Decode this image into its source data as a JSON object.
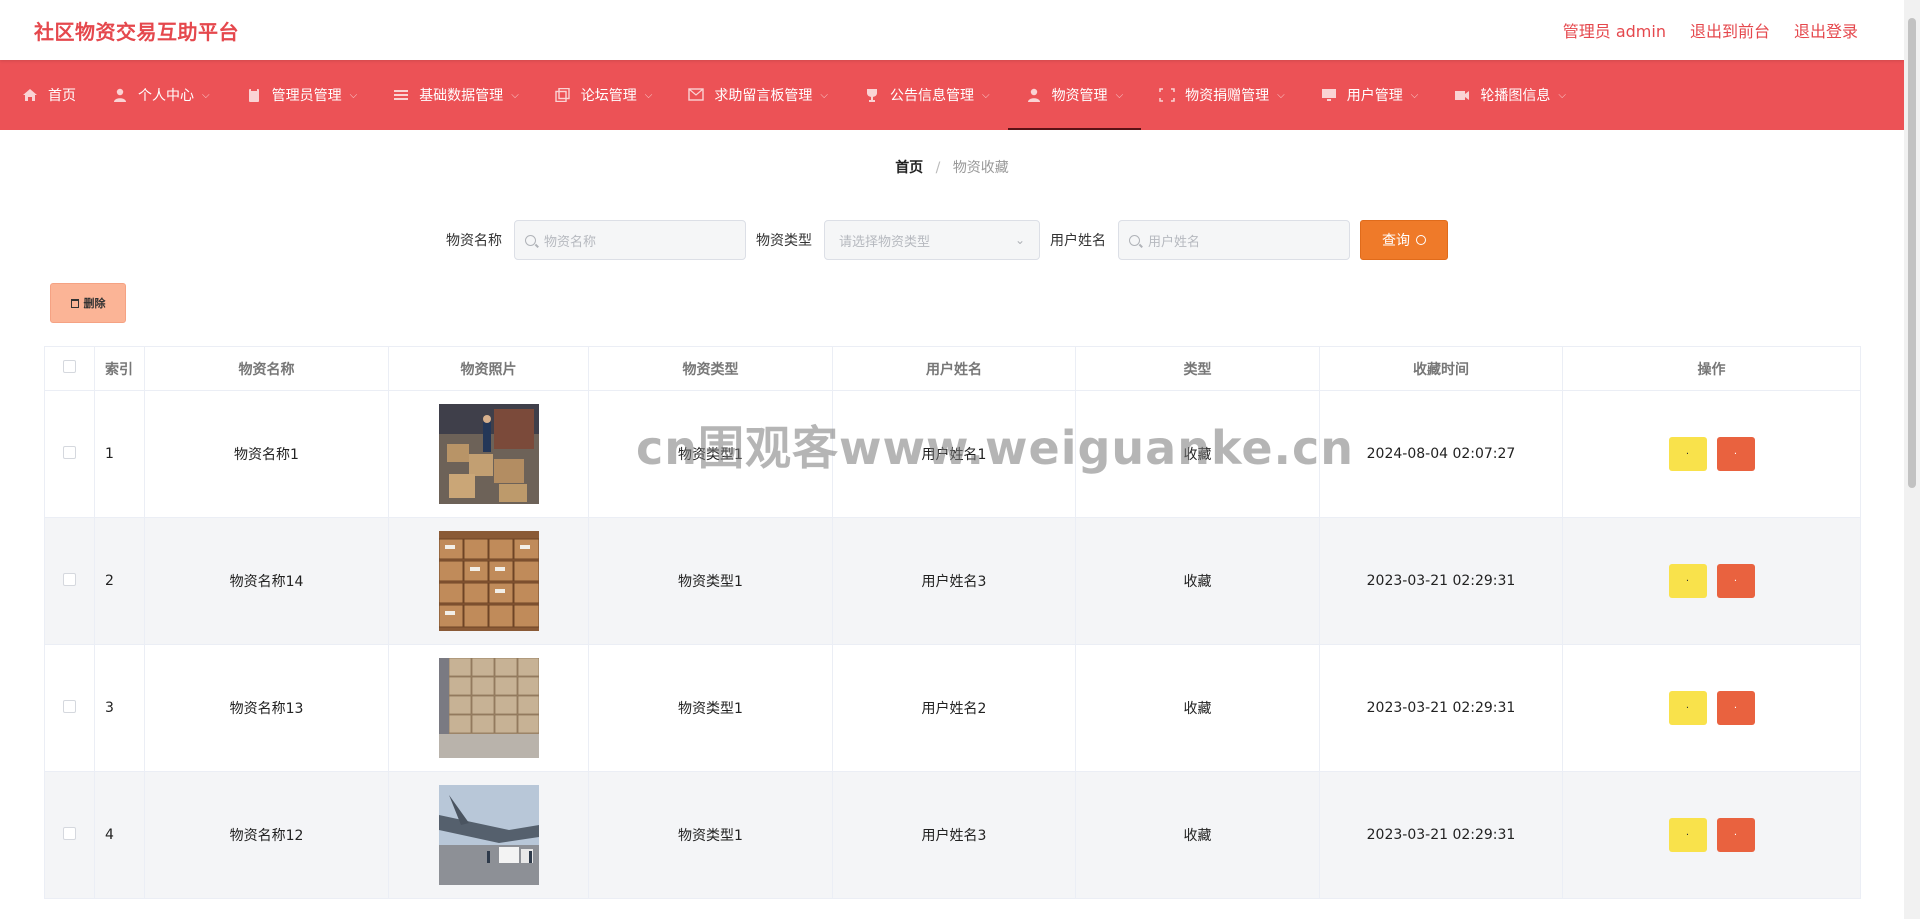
{
  "header": {
    "brand": "社区物资交易互助平台",
    "links": [
      "管理员 admin",
      "退出到前台",
      "退出登录"
    ]
  },
  "nav": {
    "items": [
      {
        "label": "首页",
        "icon": "home-icon",
        "caret": false,
        "active": false
      },
      {
        "label": "个人中心",
        "icon": "user-icon",
        "caret": true,
        "active": false
      },
      {
        "label": "管理员管理",
        "icon": "clipboard-icon",
        "caret": true,
        "active": false
      },
      {
        "label": "基础数据管理",
        "icon": "list-icon",
        "caret": true,
        "active": false
      },
      {
        "label": "论坛管理",
        "icon": "copy-icon",
        "caret": true,
        "active": false
      },
      {
        "label": "求助留言板管理",
        "icon": "message-icon",
        "caret": true,
        "active": false
      },
      {
        "label": "公告信息管理",
        "icon": "trophy-icon",
        "caret": true,
        "active": false
      },
      {
        "label": "物资管理",
        "icon": "person-icon",
        "caret": true,
        "active": true
      },
      {
        "label": "物资捐赠管理",
        "icon": "fullscreen-icon",
        "caret": true,
        "active": false
      },
      {
        "label": "用户管理",
        "icon": "monitor-icon",
        "caret": true,
        "active": false
      },
      {
        "label": "轮播图信息",
        "icon": "camera-icon",
        "caret": true,
        "active": false
      }
    ]
  },
  "breadcrumb": {
    "home": "首页",
    "sep": "/",
    "current": "物资收藏"
  },
  "search": {
    "name_label": "物资名称",
    "name_placeholder": "物资名称",
    "type_label": "物资类型",
    "type_placeholder": "请选择物资类型",
    "user_label": "用户姓名",
    "user_placeholder": "用户姓名",
    "query_label": "查询"
  },
  "toolbar": {
    "delete_label": "删除"
  },
  "table": {
    "headers": [
      "索引",
      "物资名称",
      "物资照片",
      "物资类型",
      "用户姓名",
      "类型",
      "收藏时间",
      "操作"
    ],
    "rows": [
      {
        "index": "1",
        "name": "物资名称1",
        "type": "物资类型1",
        "user": "用户姓名1",
        "kind": "收藏",
        "time": "2024-08-04 02:07:27",
        "photo": "warehouse-workers"
      },
      {
        "index": "2",
        "name": "物资名称14",
        "type": "物资类型1",
        "user": "用户姓名3",
        "kind": "收藏",
        "time": "2023-03-21 02:29:31",
        "photo": "stacked-boxes"
      },
      {
        "index": "3",
        "name": "物资名称13",
        "type": "物资类型1",
        "user": "用户姓名2",
        "kind": "收藏",
        "time": "2023-03-21 02:29:31",
        "photo": "carton-wall"
      },
      {
        "index": "4",
        "name": "物资名称12",
        "type": "物资类型1",
        "user": "用户姓名3",
        "kind": "收藏",
        "time": "2023-03-21 02:29:31",
        "photo": "cargo-plane"
      }
    ],
    "op_a": "·",
    "op_b": "·"
  },
  "watermark": "cn围观客www.weiguanke.cn",
  "colors": {
    "brand": "#e5484d",
    "nav_bg": "#ec5256",
    "query": "#ef7a29",
    "delete": "#fbb496",
    "op_yellow": "#f9e24b",
    "op_red": "#e9623f"
  }
}
